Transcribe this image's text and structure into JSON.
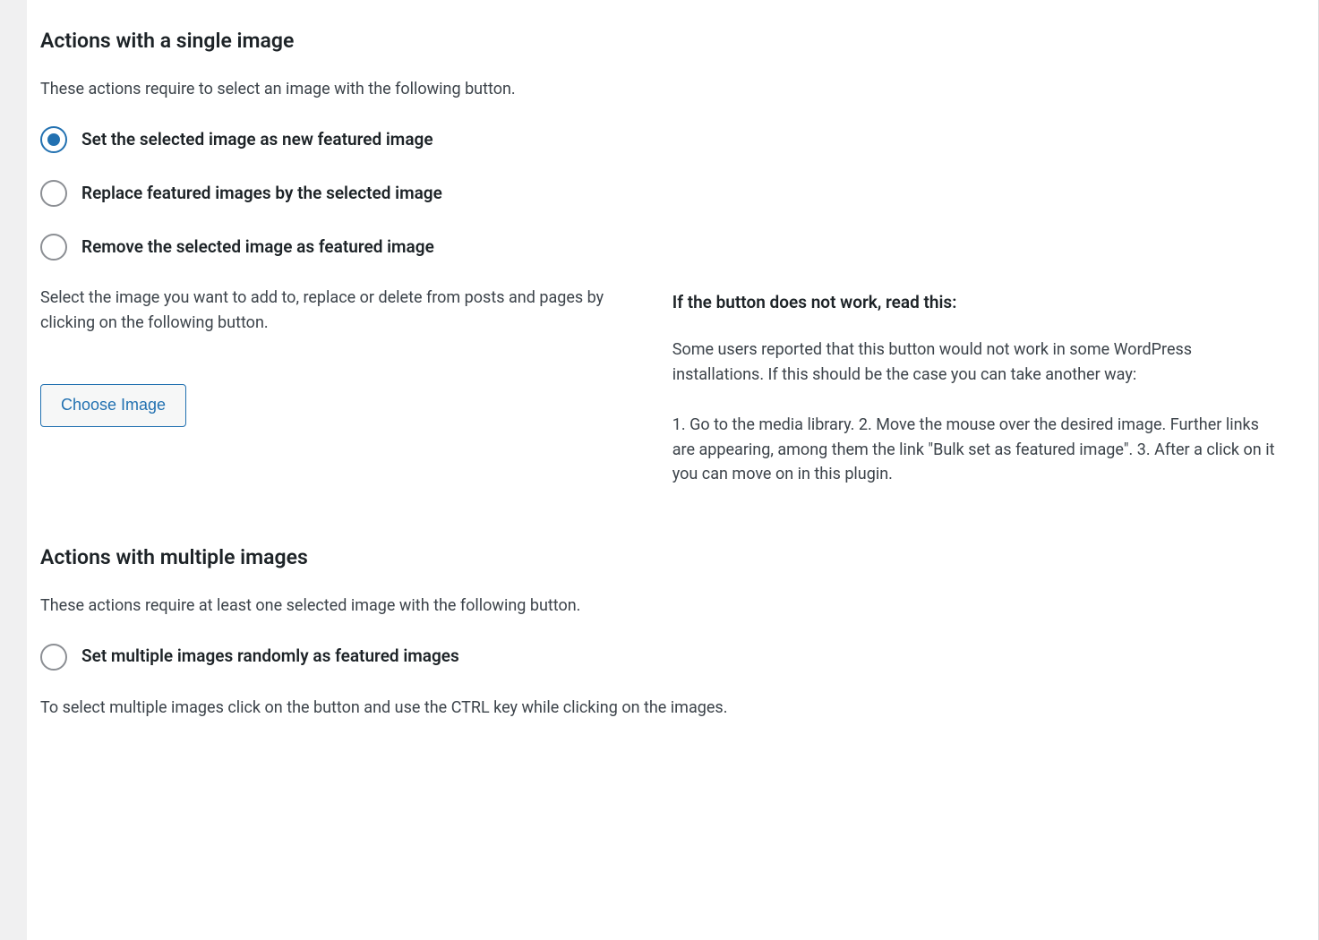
{
  "single": {
    "heading": "Actions with a single image",
    "intro": "These actions require to select an image with the following button.",
    "options": {
      "set": "Set the selected image as new featured image",
      "replace": "Replace featured images by the selected image",
      "remove": "Remove the selected image as featured image"
    },
    "select_instruction": "Select the image you want to add to, replace or delete from posts and pages by clicking on the following button.",
    "choose_button": "Choose Image",
    "help": {
      "heading": "If the button does not work, read this:",
      "para1": "Some users reported that this button would not work in some WordPress installations. If this should be the case you can take another way:",
      "para2": "1. Go to the media library. 2. Move the mouse over the desired image. Further links are appearing, among them the link \"Bulk set as featured image\". 3. After a click on it you can move on in this plugin."
    }
  },
  "multiple": {
    "heading": "Actions with multiple images",
    "intro": "These actions require at least one selected image with the following button.",
    "options": {
      "random": "Set multiple images randomly as featured images"
    },
    "select_instruction": "To select multiple images click on the button and use the CTRL key while clicking on the images."
  }
}
